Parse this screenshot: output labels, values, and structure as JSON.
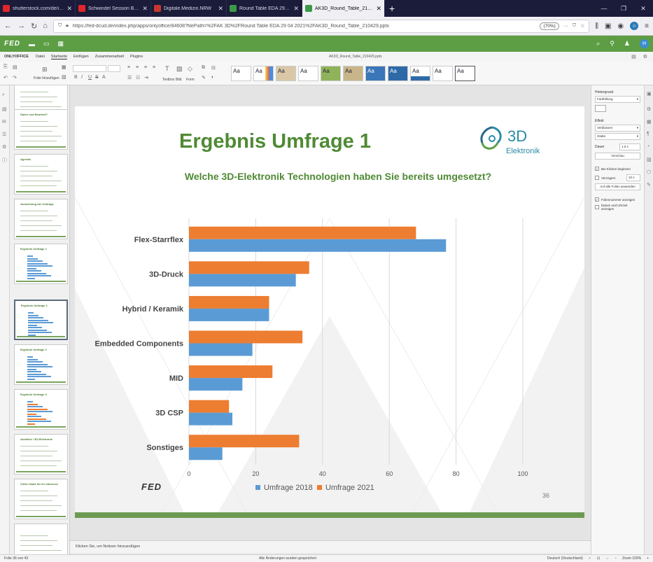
{
  "browser": {
    "tabs": [
      {
        "title": "shutterstock.com/de/image-p",
        "color": "#e0262a",
        "active": false
      },
      {
        "title": "Schwindel Session Bilder, Stoc",
        "color": "#e0262a",
        "active": false
      },
      {
        "title": "Digitale.Medizin.NRW",
        "color": "#c7372f",
        "active": false
      },
      {
        "title": "Round Table EDA 29 04 2021 - f",
        "color": "#3a9a48",
        "active": false
      },
      {
        "title": "AK3D_Round_Table_210429.pptx",
        "color": "#3a9a48",
        "active": true
      }
    ],
    "new_tab": "+",
    "window_controls": [
      "—",
      "❐",
      "✕"
    ],
    "url": "https://fed-dcud.de/index.php/apps/onlyoffice/84608?filePath=%2FAK 3D%2FRound Table EDA 29 04 2021%2FAK3D_Round_Table_210429.pptx",
    "zoom": "(70%)",
    "more": "···"
  },
  "fed": {
    "logo": "FED",
    "avatar": "H"
  },
  "editor": {
    "brand": "ONLYOFFICE",
    "menus": [
      "Datei",
      "Startseite",
      "Einfügen",
      "Zusammenarbeit",
      "Plugins"
    ],
    "selected_menu": "Startseite",
    "filename": "AK3D_Round_Table_210429.pptx",
    "toolbar": {
      "add_slide": "Folie hinzufügen",
      "textbox": "Textbox",
      "image": "Bild",
      "shape": "Form"
    },
    "themes": [
      "Aa",
      "Aa",
      "Aa",
      "Aa",
      "Aa",
      "Aa",
      "Aa",
      "Aa",
      "Aa",
      "Aa",
      "Aa"
    ]
  },
  "thumbnails": [
    {
      "num": "31",
      "title": ""
    },
    {
      "num": "32",
      "title": "Daten und Bearbeit?"
    },
    {
      "num": "33",
      "title": "Agenda"
    },
    {
      "num": "34",
      "title": "Auswertung der Umfrage"
    },
    {
      "num": "35",
      "title": "Ergebnis Umfrage 1"
    },
    {
      "num": "36",
      "title": "Ergebnis Umfrage 1"
    },
    {
      "num": "37",
      "title": "Ergebnis Umfrage 2"
    },
    {
      "num": "38",
      "title": "Ergebnis Umfrage 3"
    },
    {
      "num": "39",
      "title": "Ausblick / 3D-Elektronik"
    },
    {
      "num": "40",
      "title": "Vielen Dank für Ihr Interesse"
    },
    {
      "num": "41",
      "title": ""
    }
  ],
  "slide": {
    "title": "Ergebnis Umfrage 1",
    "subtitle": "Welche 3D-Elektronik Technologien haben Sie bereits umgesetzt?",
    "logo_3d": "3D",
    "logo_elektronik": "Elektronik",
    "footer_logo": "FED",
    "page_number": "36"
  },
  "chart_data": {
    "type": "bar",
    "orientation": "horizontal",
    "categories": [
      "Flex-Starrflex",
      "3D-Druck",
      "Hybrid / Keramik",
      "Embedded Components",
      "MID",
      "3D CSP",
      "Sonstiges"
    ],
    "series": [
      {
        "name": "Umfrage 2018",
        "color": "#5b9bd5",
        "values": [
          77,
          32,
          24,
          19,
          16,
          13,
          10
        ]
      },
      {
        "name": "Umfrage 2021",
        "color": "#ed7d31",
        "values": [
          68,
          36,
          24,
          34,
          25,
          12,
          33
        ]
      }
    ],
    "xlim": [
      0,
      100
    ],
    "xticks": [
      "0",
      "20",
      "40",
      "60",
      "80",
      "100"
    ],
    "grid": true,
    "legend": "bottom"
  },
  "notes": {
    "placeholder": "Klicken Sie, um Notizen hinzuzufügen"
  },
  "right_panel": {
    "background_label": "Hintergrund",
    "fill": "Farbfüllung",
    "effect_label": "Effekt",
    "effect": "Verblassen",
    "effect_option": "Glatte",
    "duration_label": "Dauer",
    "duration": "1.0 s",
    "preview": "Vorschau",
    "start_on_click": "Bei Klicken beginnen",
    "delay_label": "Verzögern",
    "delay": "10 s",
    "apply_all": "Auf alle Folien anwenden",
    "show_slide_number": "Foliennummer anzeigen",
    "show_date": "Datum und Uhrzeit anzeigen"
  },
  "status": {
    "slide_of": "Folie 36 von 43",
    "saved": "Alle Änderungen wurden gespeichert",
    "language": "Deutsch (Deutschland)",
    "zoom": "Zoom 100%"
  }
}
